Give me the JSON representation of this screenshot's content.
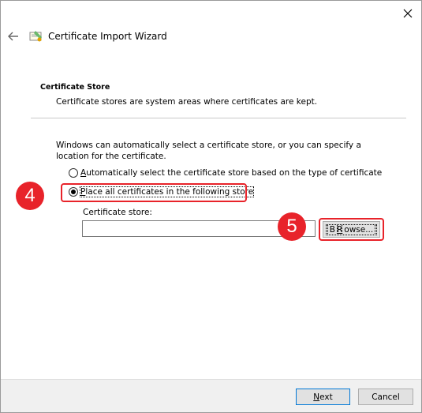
{
  "window": {
    "title": "Certificate Import Wizard",
    "close_icon": "close-icon",
    "back_icon": "back-arrow-icon",
    "title_icon": "certificate-icon"
  },
  "section": {
    "title": "Certificate Store",
    "description": "Certificate stores are system areas where certificates are kept."
  },
  "intro": "Windows can automatically select a certificate store, or you can specify a location for the certificate.",
  "options": {
    "auto": {
      "accel": "A",
      "rest": "utomatically select the certificate store based on the type of certificate",
      "checked": false
    },
    "place": {
      "accel": "P",
      "rest": "lace all certificates in the following store",
      "checked": true
    }
  },
  "store": {
    "label": "Certificate store:",
    "value": ""
  },
  "buttons": {
    "browse_accel": "R",
    "browse_pre": "B",
    "browse_post": "owse...",
    "next_accel": "N",
    "next_rest": "ext",
    "cancel": "Cancel"
  },
  "annotations": {
    "step4": "4",
    "step5": "5",
    "highlight_color": "#e8232a"
  },
  "colors": {
    "accent": "#0078d7",
    "footer_bg": "#f0f0f0"
  }
}
